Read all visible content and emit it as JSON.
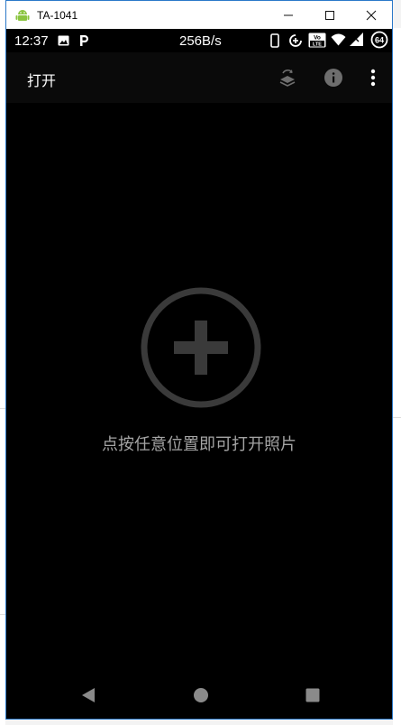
{
  "window": {
    "title": "TA-1041"
  },
  "status_bar": {
    "time": "12:37",
    "net_speed": "256B/s",
    "lte_badge_top": "Vo",
    "lte_badge_bottom": "LTE",
    "battery_level": "64"
  },
  "toolbar": {
    "title": "打开"
  },
  "main": {
    "hint": "点按任意位置即可打开照片"
  },
  "colors": {
    "window_border": "#2b79c9",
    "screen_background": "#000000",
    "hint_text": "#a4a4a4",
    "add_icon": "#3a3a3a"
  },
  "icons": {
    "titlebar": "android-icon",
    "status": [
      "image-icon",
      "p-app-icon",
      "phone-icon",
      "data-saver-icon",
      "volte-icon",
      "wifi-icon",
      "signal-icon",
      "battery-icon"
    ],
    "toolbar": [
      "switch-layers-icon",
      "info-icon",
      "more-vert-icon"
    ],
    "content": "add-circle-icon",
    "nav": [
      "back-icon",
      "home-icon",
      "recents-icon"
    ]
  }
}
